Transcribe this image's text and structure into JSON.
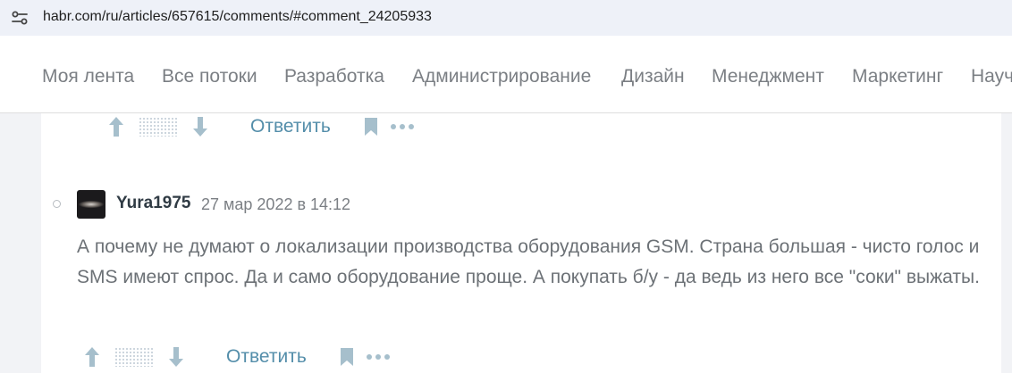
{
  "browser": {
    "url": "habr.com/ru/articles/657615/comments/#comment_24205933"
  },
  "nav": {
    "items": [
      "Моя лента",
      "Все потоки",
      "Разработка",
      "Администрирование",
      "Дизайн",
      "Менеджмент",
      "Маркетинг",
      "Научпоп"
    ]
  },
  "previous_comment": {
    "reply_label": "Ответить"
  },
  "comment": {
    "author": "Yura1975",
    "timestamp": "27 мар 2022 в 14:12",
    "text": "А почему не думают о локализации производства оборудования GSM. Страна большая - чисто голос и SMS имеют спрос. Да и само оборудование проще. А покупать б/у - да ведь из него все \"соки\" выжаты.",
    "reply_label": "Ответить"
  },
  "colors": {
    "link": "#548eaa",
    "muted": "#7b7f84",
    "icon": "#a6bfcc"
  },
  "icons": [
    "site-info-icon",
    "upvote-icon",
    "downvote-icon",
    "bookmark-icon",
    "more-icon"
  ]
}
